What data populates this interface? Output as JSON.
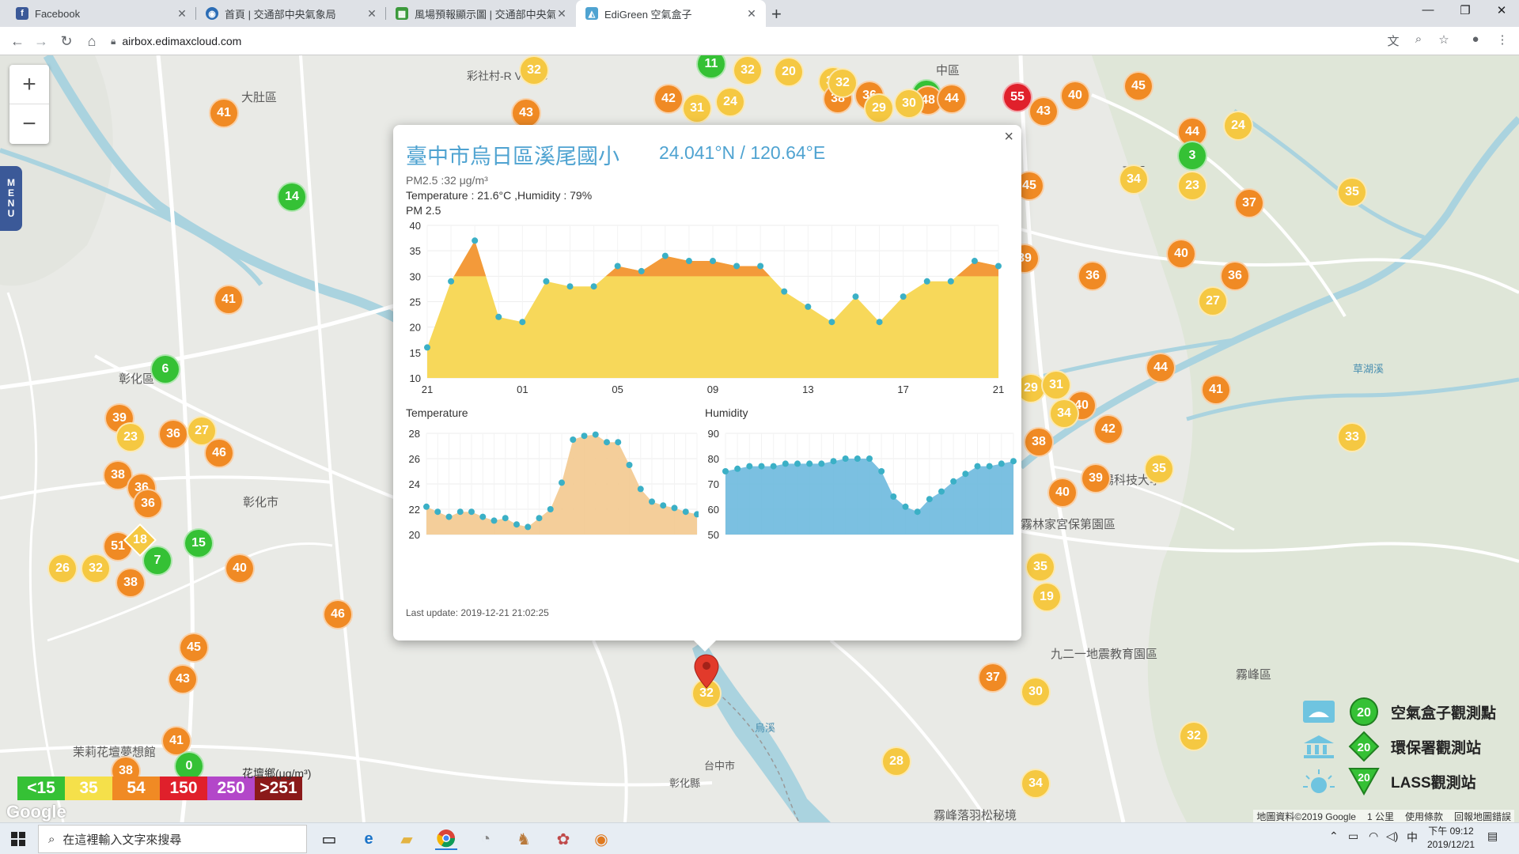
{
  "browser": {
    "tabs": [
      {
        "title": "Facebook",
        "active": false
      },
      {
        "title": "首頁 | 交通部中央氣象局",
        "active": false
      },
      {
        "title": "風場預報顯示圖 | 交通部中央氣象",
        "active": false
      },
      {
        "title": "EdiGreen 空氣盒子",
        "active": true
      }
    ],
    "url": "airbox.edimaxcloud.com"
  },
  "map": {
    "place_labels": [
      {
        "id": "dadu",
        "text": "大肚區"
      },
      {
        "id": "changhua-district",
        "text": "彰化區"
      },
      {
        "id": "changhua-city",
        "text": "彰化市"
      },
      {
        "id": "zhongqu",
        "text": "中區"
      },
      {
        "id": "pingqu",
        "text": "平區"
      },
      {
        "id": "wufeng",
        "text": "霧峰區"
      },
      {
        "id": "linjia",
        "text": "霧林家宮保第園區"
      },
      {
        "id": "jiuyi",
        "text": "九二一地震教育園區"
      },
      {
        "id": "huatan",
        "text": "花壇鄉"
      },
      {
        "id": "molihua",
        "text": "茉莉花壇夢想館"
      },
      {
        "id": "feather",
        "text": "霧峰落羽松秘境"
      },
      {
        "id": "chaoyang",
        "text": "朝陽科技大學"
      },
      {
        "id": "caohu",
        "text": "草湖溪"
      },
      {
        "id": "village",
        "text": "彩社村-R Village"
      },
      {
        "id": "taichung",
        "text": "台中市"
      },
      {
        "id": "changhua-county",
        "text": "彰化縣"
      },
      {
        "id": "wuxi",
        "text": "烏溪"
      }
    ],
    "markers": [
      {
        "v": "11",
        "c": "#35c135"
      },
      {
        "v": "32",
        "c": "#f5c842"
      },
      {
        "v": "20",
        "c": "#f5c842"
      },
      {
        "v": "34",
        "c": "#f5c842"
      },
      {
        "v": "36",
        "c": "#f08a24"
      },
      {
        "v": "14",
        "c": "#35c135"
      },
      {
        "v": "55",
        "c": "#e0202b"
      },
      {
        "v": "43",
        "c": "#f08a24"
      },
      {
        "v": "40",
        "c": "#f08a24"
      },
      {
        "v": "45",
        "c": "#f08a24"
      },
      {
        "v": "44",
        "c": "#f08a24"
      },
      {
        "v": "24",
        "c": "#f5c842"
      },
      {
        "v": "3",
        "c": "#35c135"
      },
      {
        "v": "23",
        "c": "#f5c842"
      },
      {
        "v": "34",
        "c": "#f5c842"
      },
      {
        "v": "35",
        "c": "#f5c842"
      },
      {
        "v": "37",
        "c": "#f08a24"
      },
      {
        "v": "45",
        "c": "#f08a24"
      },
      {
        "v": "39",
        "c": "#f08a24"
      },
      {
        "v": "40",
        "c": "#f08a24"
      },
      {
        "v": "36",
        "c": "#f08a24"
      },
      {
        "v": "36",
        "c": "#f08a24"
      },
      {
        "v": "27",
        "c": "#f5c842"
      },
      {
        "v": "44",
        "c": "#f08a24"
      },
      {
        "v": "29",
        "c": "#f5c842"
      },
      {
        "v": "31",
        "c": "#f5c842"
      },
      {
        "v": "40",
        "c": "#f08a24"
      },
      {
        "v": "41",
        "c": "#f08a24"
      },
      {
        "v": "34",
        "c": "#f5c842"
      },
      {
        "v": "42",
        "c": "#f08a24"
      },
      {
        "v": "33",
        "c": "#f5c842"
      },
      {
        "v": "38",
        "c": "#f08a24"
      },
      {
        "v": "35",
        "c": "#f5c842"
      },
      {
        "v": "40",
        "c": "#f08a24"
      },
      {
        "v": "39",
        "c": "#f08a24"
      },
      {
        "v": "35",
        "c": "#f5c842"
      },
      {
        "v": "19",
        "c": "#f5c842"
      },
      {
        "v": "37",
        "c": "#f08a24"
      },
      {
        "v": "30",
        "c": "#f5c842"
      },
      {
        "v": "32",
        "c": "#f5c842"
      },
      {
        "v": "28",
        "c": "#f5c842"
      },
      {
        "v": "34",
        "c": "#f5c842"
      },
      {
        "v": "32",
        "c": "#f5c842"
      },
      {
        "v": "43",
        "c": "#f08a24"
      },
      {
        "v": "42",
        "c": "#f08a24"
      },
      {
        "v": "38",
        "c": "#f08a24"
      },
      {
        "v": "31",
        "c": "#f5c842"
      },
      {
        "v": "24",
        "c": "#f5c842"
      },
      {
        "v": "29",
        "c": "#f5c842"
      },
      {
        "v": "48",
        "c": "#f08a24"
      },
      {
        "v": "44",
        "c": "#f08a24"
      },
      {
        "v": "14",
        "c": "#35c135"
      },
      {
        "v": "41",
        "c": "#f08a24"
      },
      {
        "v": "41",
        "c": "#f08a24"
      },
      {
        "v": "6",
        "c": "#35c135"
      },
      {
        "v": "39",
        "c": "#f08a24"
      },
      {
        "v": "23",
        "c": "#f5c842"
      },
      {
        "v": "36",
        "c": "#f08a24"
      },
      {
        "v": "27",
        "c": "#f5c842"
      },
      {
        "v": "46",
        "c": "#f08a24"
      },
      {
        "v": "38",
        "c": "#f08a24"
      },
      {
        "v": "36",
        "c": "#f08a24"
      },
      {
        "v": "36",
        "c": "#f08a24"
      },
      {
        "v": "51",
        "c": "#f08a24"
      },
      {
        "v": "15",
        "c": "#35c135"
      },
      {
        "v": "7",
        "c": "#35c135"
      },
      {
        "v": "26",
        "c": "#f5c842"
      },
      {
        "v": "32",
        "c": "#f5c842"
      },
      {
        "v": "38",
        "c": "#f08a24"
      },
      {
        "v": "40",
        "c": "#f08a24"
      },
      {
        "v": "46",
        "c": "#f08a24"
      },
      {
        "v": "45",
        "c": "#f08a24"
      },
      {
        "v": "43",
        "c": "#f08a24"
      },
      {
        "v": "41",
        "c": "#f08a24"
      },
      {
        "v": "0",
        "c": "#35c135"
      },
      {
        "v": "38",
        "c": "#f08a24"
      },
      {
        "v": "30",
        "c": "#f5c842"
      },
      {
        "v": "32",
        "c": "#f5c842"
      }
    ],
    "diamond_marker": {
      "v": "18",
      "c": "#f5c842"
    },
    "selected_marker": {
      "v": "32",
      "c": "#f5c842"
    },
    "zoom_in": "+",
    "zoom_out": "−",
    "menu_label": "MENU",
    "legend": [
      {
        "label": "<15",
        "color": "#35c135"
      },
      {
        "label": "35",
        "color": "#f5c842"
      },
      {
        "label": "54",
        "color": "#f08a24"
      },
      {
        "label": "150",
        "color": "#e0202b"
      },
      {
        "label": "250",
        "color": "#b347c9"
      },
      {
        "label": ">251",
        "color": "#8b1a1a"
      }
    ],
    "legend_unit": "(μg/m³)",
    "google_logo": "Google",
    "key": [
      {
        "label": "空氣盒子觀測點",
        "num": "20",
        "shape": "circle"
      },
      {
        "label": "環保署觀測站",
        "num": "20",
        "shape": "diamond"
      },
      {
        "label": "LASS觀測站",
        "num": "20",
        "shape": "triangle"
      }
    ],
    "attribution": [
      "地圖資料©2019 Google",
      "1 公里",
      "使用條款",
      "回報地圖錯誤"
    ]
  },
  "popup": {
    "title": "臺中市烏日區溪尾國小",
    "coords": "24.041°N / 120.64°E",
    "pm25_line": "PM2.5 :32 μg/m³",
    "temp_line": "Temperature : 21.6°C ,Humidity : 79%",
    "chart_heading": "PM 2.5",
    "temp_heading": "Temperature",
    "hum_heading": "Humidity",
    "last_update": "Last update: 2019-12-21 21:02:25",
    "close": "×"
  },
  "chart_data": [
    {
      "type": "area",
      "title": "PM 2.5",
      "x": [
        "21",
        "",
        "",
        "",
        "01",
        "",
        "",
        "",
        "05",
        "",
        "",
        "",
        "09",
        "",
        "",
        "",
        "13",
        "",
        "",
        "",
        "17",
        "",
        "",
        "",
        "21"
      ],
      "xtick_labels": [
        "21",
        "01",
        "05",
        "09",
        "13",
        "17",
        "21"
      ],
      "values": [
        16,
        29,
        37,
        22,
        21,
        29,
        28,
        28,
        32,
        31,
        34,
        33,
        33,
        32,
        32,
        27,
        24,
        21,
        26,
        21,
        26,
        29,
        29,
        33,
        32
      ],
      "ylim": [
        10,
        40
      ],
      "yticks": [
        10,
        15,
        20,
        25,
        30,
        35,
        40
      ],
      "threshold": 30,
      "colors": {
        "below": "#f7d85a",
        "above": "#f39a3a",
        "point": "#3bb0c6"
      }
    },
    {
      "type": "area",
      "title": "Temperature",
      "values": [
        22.2,
        21.8,
        21.4,
        21.8,
        21.8,
        21.4,
        21.1,
        21.3,
        20.8,
        20.6,
        21.3,
        22.0,
        24.1,
        27.5,
        27.8,
        27.9,
        27.3,
        27.3,
        25.5,
        23.6,
        22.6,
        22.3,
        22.1,
        21.8,
        21.6
      ],
      "ylim": [
        20,
        28
      ],
      "yticks": [
        20,
        22,
        24,
        26,
        28
      ],
      "colors": {
        "fill": "#f3c98f",
        "point": "#3bb0c6"
      }
    },
    {
      "type": "area",
      "title": "Humidity",
      "values": [
        75,
        76,
        77,
        77,
        77,
        78,
        78,
        78,
        78,
        79,
        80,
        80,
        80,
        75,
        65,
        61,
        59,
        64,
        67,
        71,
        74,
        77,
        77,
        78,
        79
      ],
      "ylim": [
        50,
        90
      ],
      "yticks": [
        50,
        60,
        70,
        80,
        90
      ],
      "colors": {
        "fill": "#6db9de",
        "point": "#3bb0c6"
      }
    }
  ],
  "taskbar": {
    "search_placeholder": "在這裡輸入文字來搜尋",
    "time": "下午 09:12",
    "date": "2019/12/21",
    "ime": "中"
  }
}
